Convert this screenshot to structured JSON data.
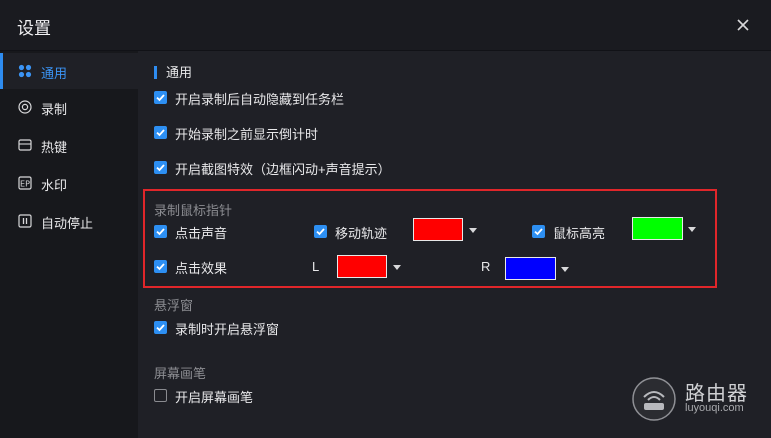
{
  "window": {
    "title": "设置"
  },
  "sidebar": {
    "items": [
      {
        "label": "通用",
        "icon": "grid-icon",
        "active": true
      },
      {
        "label": "录制",
        "icon": "record-icon",
        "active": false
      },
      {
        "label": "热键",
        "icon": "keyboard-icon",
        "active": false
      },
      {
        "label": "水印",
        "icon": "watermark-icon",
        "active": false
      },
      {
        "label": "自动停止",
        "icon": "pause-icon",
        "active": false
      }
    ]
  },
  "main": {
    "section_title": "通用",
    "general_options": [
      {
        "label": "开启录制后自动隐藏到任务栏",
        "checked": true
      },
      {
        "label": "开始录制之前显示倒计时",
        "checked": true
      },
      {
        "label": "开启截图特效（边框闪动+声音提示）",
        "checked": true
      }
    ],
    "mouse": {
      "group_label": "录制鼠标指针",
      "click_sound": {
        "label": "点击声音",
        "checked": true
      },
      "move_track": {
        "label": "移动轨迹",
        "checked": true,
        "color": "#ff0000"
      },
      "highlight": {
        "label": "鼠标高亮",
        "checked": true,
        "color": "#00ff00"
      },
      "click_effect": {
        "label": "点击效果",
        "checked": true
      },
      "left": {
        "label": "L",
        "color": "#ff0000"
      },
      "right": {
        "label": "R",
        "color": "#0000ff"
      }
    },
    "float_window": {
      "group_label": "悬浮窗",
      "option": {
        "label": "录制时开启悬浮窗",
        "checked": true
      }
    },
    "screen_pen": {
      "group_label": "屏幕画笔",
      "option": {
        "label": "开启屏幕画笔",
        "checked": false
      }
    }
  },
  "watermark": {
    "main": "路由器",
    "sub": "luyouqi.com"
  },
  "colors": {
    "accent": "#2e8cf0",
    "highlight_box": "#e0262a"
  }
}
